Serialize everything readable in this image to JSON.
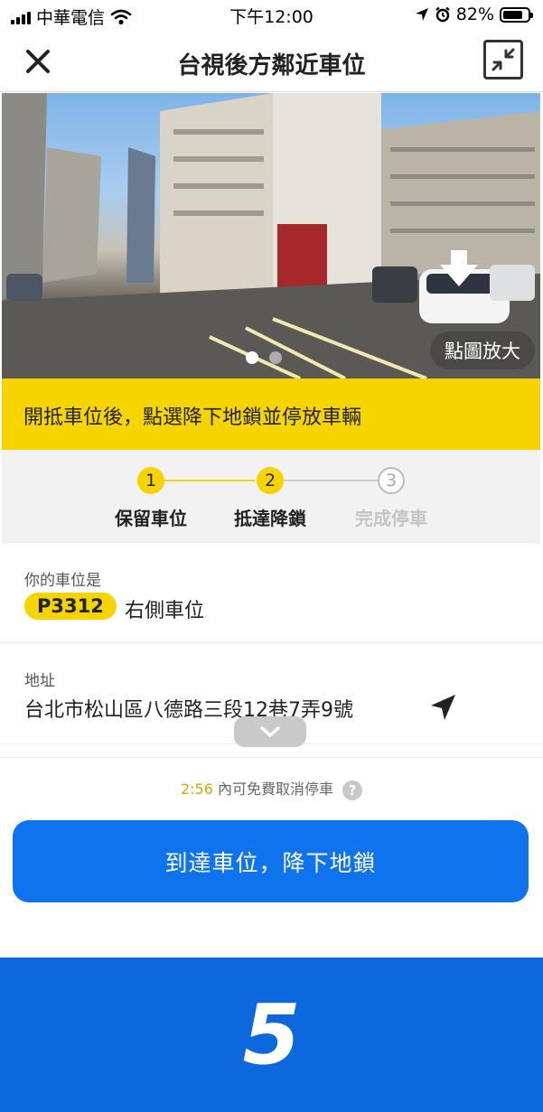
{
  "status_bar": {
    "carrier": "中華電信",
    "time": "下午12:00",
    "battery_percent": "82%",
    "battery_level": 0.82,
    "icons": [
      "signal-icon",
      "wifi-icon",
      "location-arrow-icon",
      "alarm-icon",
      "battery-icon"
    ]
  },
  "header": {
    "title": "台視後方鄰近車位",
    "close_icon": "close-icon",
    "minimize_icon": "minimize-icon"
  },
  "photo": {
    "zoom_hint": "點圖放大",
    "page_count": 2,
    "active_page": 1
  },
  "banner": {
    "text": "開抵車位後，點選降下地鎖並停放車輛"
  },
  "steps": [
    {
      "number": "1",
      "label": "保留車位",
      "state": "done"
    },
    {
      "number": "2",
      "label": "抵達降鎖",
      "state": "done"
    },
    {
      "number": "3",
      "label": "完成停車",
      "state": "todo"
    }
  ],
  "spot": {
    "label": "你的車位是",
    "code": "P3312",
    "side": "右側車位"
  },
  "address": {
    "label": "地址",
    "value": "台北市松山區八德路三段12巷7弄9號"
  },
  "cancel": {
    "countdown": "2:56",
    "text": " 內可免費取消停車",
    "help": "?"
  },
  "actions": {
    "arrive_label": "到達車位，降下地鎖"
  },
  "bottom_overlay": {
    "number": "5"
  },
  "colors": {
    "brand_yellow": "#f5d400",
    "brand_blue": "#0f73ee",
    "overlay_blue": "#0c68dc",
    "countdown_orange": "#e6a200"
  }
}
